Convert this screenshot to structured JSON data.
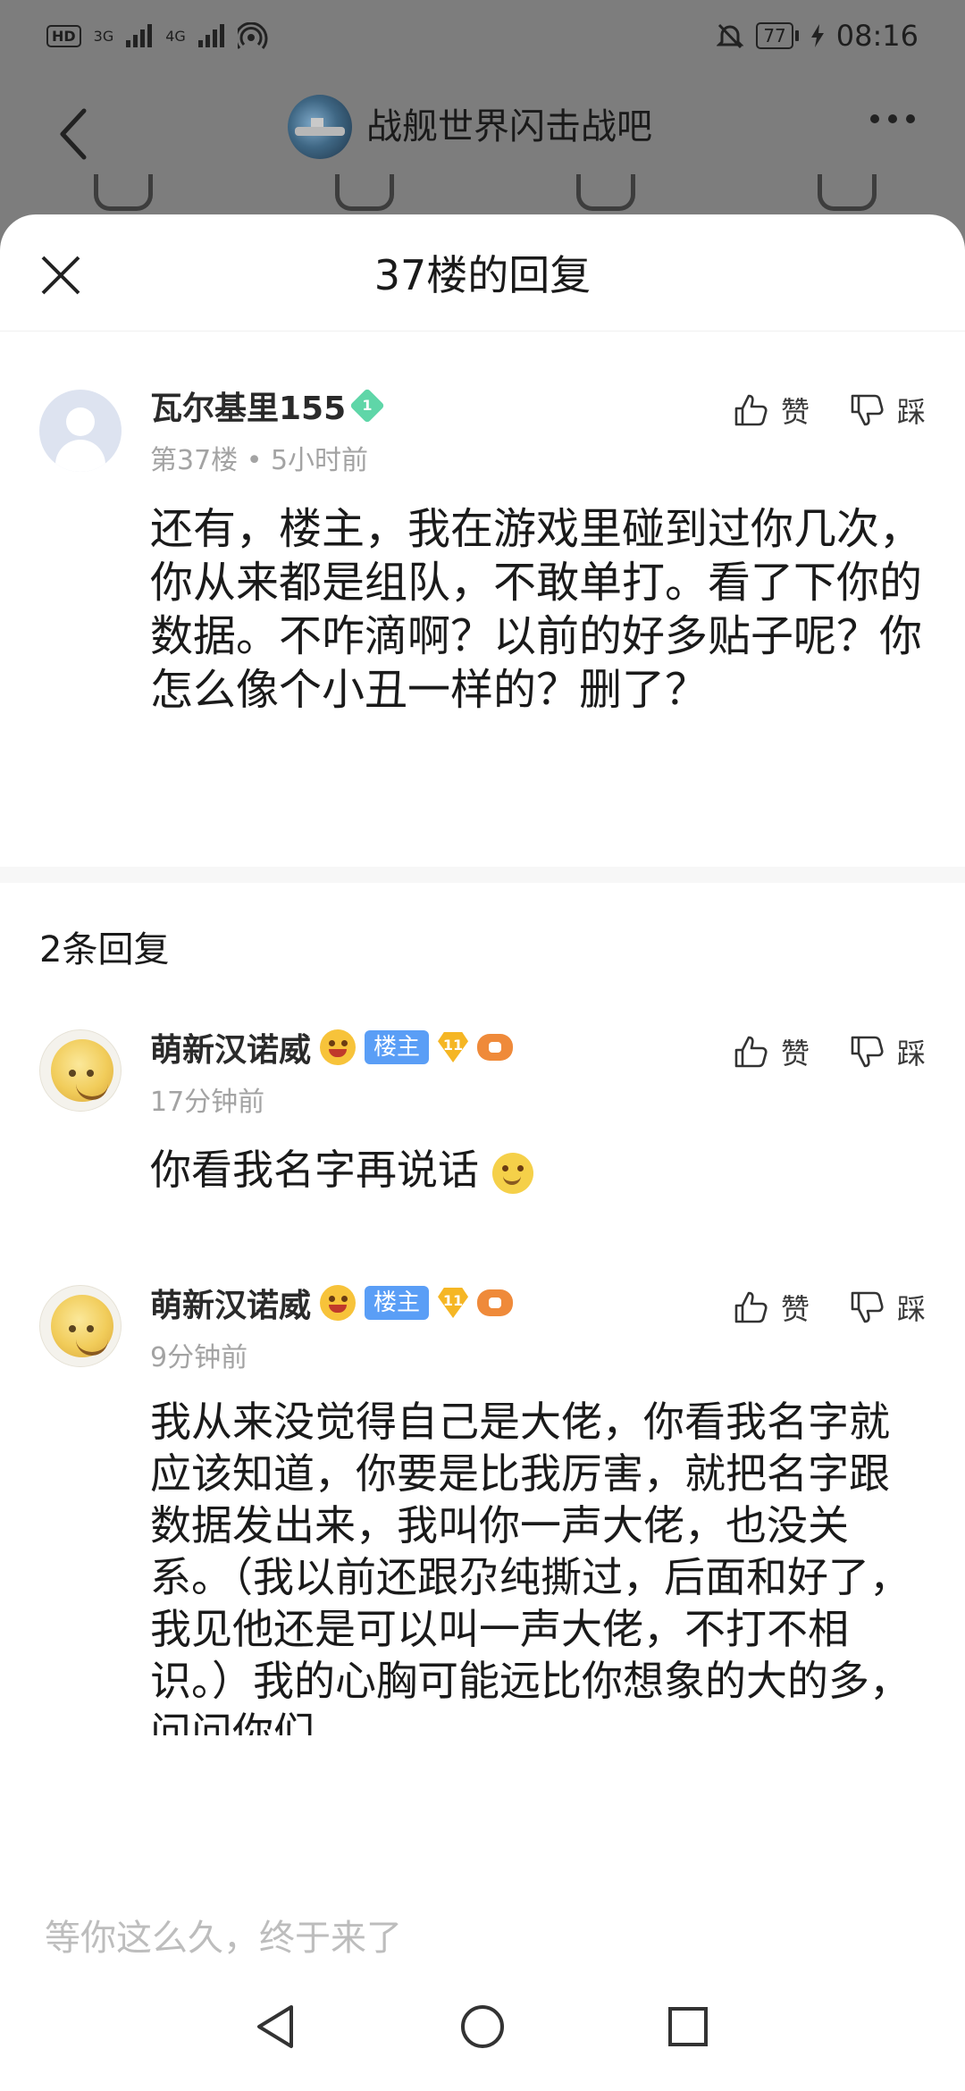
{
  "status": {
    "left_chip": "HD",
    "net1": "3G",
    "net2": "4G",
    "battery": "77",
    "time": "08:16"
  },
  "header": {
    "forum_title": "战舰世界闪击战吧"
  },
  "sheet": {
    "title": "37楼的回复"
  },
  "main_post": {
    "username": "瓦尔基里155",
    "level": "1",
    "floor": "第37楼",
    "time": "5小时前",
    "like_label": "赞",
    "dislike_label": "踩",
    "content": "还有，楼主，我在游戏里碰到过你几次，你从来都是组队，不敢单打。看了下你的数据。不咋滴啊？以前的好多贴子呢？你怎么像个小丑一样的？删了？"
  },
  "replies_count": "2条回复",
  "replies": [
    {
      "username": "萌新汉诺威",
      "owner_tag": "楼主",
      "level": "11",
      "time": "17分钟前",
      "like_label": "赞",
      "dislike_label": "踩",
      "content": "你看我名字再说话"
    },
    {
      "username": "萌新汉诺威",
      "owner_tag": "楼主",
      "level": "11",
      "time": "9分钟前",
      "like_label": "赞",
      "dislike_label": "踩",
      "content": "我从来没觉得自己是大佬，你看我名字就应该知道，你要是比我厉害，就把名字跟数据发出来，我叫你一声大佬，也没关系。（我以前还跟尕纯撕过，后面和好了，我见他还是可以叫一声大佬，不打不相识。）我的心胸可能远比你想象的大的多，问问你们"
    }
  ],
  "input": {
    "placeholder": "等你这么久，终于来了"
  }
}
